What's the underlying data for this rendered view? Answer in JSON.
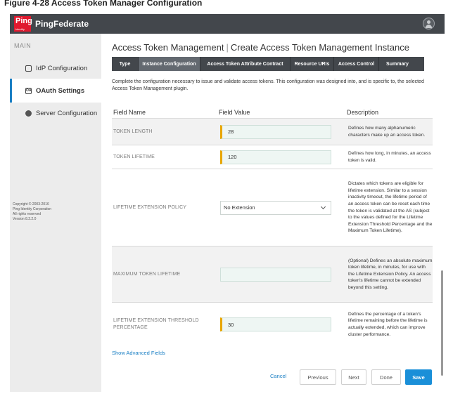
{
  "caption": "Figure 4-28 Access Token Manager Configuration",
  "header": {
    "logo_mark": "Ping",
    "logo_sub": "Identity",
    "product": "PingFederate"
  },
  "sidebar": {
    "section": "MAIN",
    "items": [
      {
        "label": "IdP Configuration",
        "icon": "document-icon",
        "active": false
      },
      {
        "label": "OAuth Settings",
        "icon": "oauth-icon",
        "active": true
      },
      {
        "label": "Server Configuration",
        "icon": "server-icon",
        "active": false
      }
    ],
    "oauth_icon_text": "OA",
    "copyright": [
      "Copyright © 2003-2016",
      "Ping Identity Corporation",
      "All rights reserved",
      "Version 8.2.2.0"
    ]
  },
  "page": {
    "title_left": "Access Token Management",
    "title_sep": "|",
    "title_right": "Create Access Token Management Instance",
    "tabs": [
      {
        "label": "Type",
        "active": false
      },
      {
        "label": "Instance Configuration",
        "active": true
      },
      {
        "label": "Access Token Attribute Contract",
        "active": false
      },
      {
        "label": "Resource URIs",
        "active": false
      },
      {
        "label": "Access Control",
        "active": false
      },
      {
        "label": "Summary",
        "active": false
      }
    ],
    "intro": "Complete the configuration necessary to issue and validate access tokens. This configuration was designed into, and is specific to, the selected Access Token Management plugin."
  },
  "table": {
    "headers": [
      "Field Name",
      "Field Value",
      "Description"
    ],
    "rows": [
      {
        "name": "TOKEN LENGTH",
        "value": "28",
        "kind": "input",
        "required": true,
        "description": "Defines how many alphanumeric characters make up an access token."
      },
      {
        "name": "TOKEN LIFETIME",
        "value": "120",
        "kind": "input",
        "required": true,
        "description": "Defines how long, in minutes, an access token is valid."
      },
      {
        "name": "LIFETIME EXTENSION POLICY",
        "value": "No Extension",
        "kind": "select",
        "required": false,
        "description": "Dictates which tokens are eligible for lifetime extension. Similar to a session inactivity timeout, the lifetime period of an access token can be reset each time the token is validated at the AS (subject to the values defined for the Lifetime Extension Threshold Percentage and the Maximum Token Lifetime)."
      },
      {
        "name": "MAXIMUM TOKEN LIFETIME",
        "value": "",
        "kind": "input",
        "required": false,
        "description": "(Optional) Defines an absolute maximum token lifetime, in minutes, for use with the Lifetime Extension Policy. An access token's lifetime cannot be extended beyond this setting."
      },
      {
        "name": "LIFETIME EXTENSION THRESHOLD PERCENTAGE",
        "value": "30",
        "kind": "input",
        "required": true,
        "description": "Defines the percentage of a token's lifetime remaining before the lifetime is actually extended, which can improve cluster performance."
      }
    ]
  },
  "advanced_link": "Show Advanced Fields",
  "buttons": {
    "cancel": "Cancel",
    "previous": "Previous",
    "next": "Next",
    "done": "Done",
    "save": "Save"
  },
  "colors": {
    "topbar": "#43474c",
    "accent": "#1a8fd8",
    "required_marker": "#e8a600",
    "brand_red": "#e0192f"
  }
}
